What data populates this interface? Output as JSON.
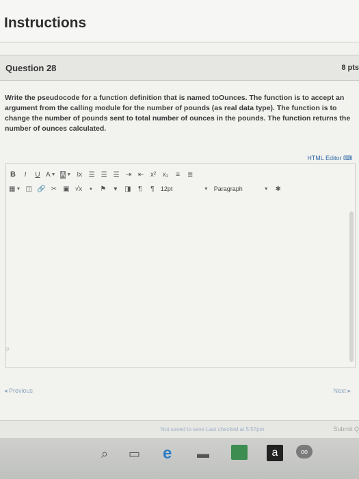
{
  "header": {
    "title": "Instructions"
  },
  "question": {
    "title": "Question 28",
    "points": "8 pts",
    "text": "Write the pseudocode for a function definition that is named toOunces. The function is to accept an argument from the calling module for the number of pounds (as real data type). The function is to change the number of pounds sent to total number of ounces in the pounds. The function returns the number of ounces calculated."
  },
  "editor": {
    "html_editor_label": "HTML Editor",
    "toolbar1": [
      "B",
      "I",
      "U",
      "A",
      "A",
      "Ix",
      "x²",
      "x₂"
    ],
    "font_size": "12pt",
    "paragraph": "Paragraph",
    "path_label": "p"
  },
  "navigation": {
    "previous": "◂ Previous",
    "next": "Next ▸"
  },
  "footer": {
    "status": "Not saved to save Last checked at 5:57pm",
    "submit": "Submit Q"
  },
  "taskbar": {
    "amazon_label": "a"
  }
}
